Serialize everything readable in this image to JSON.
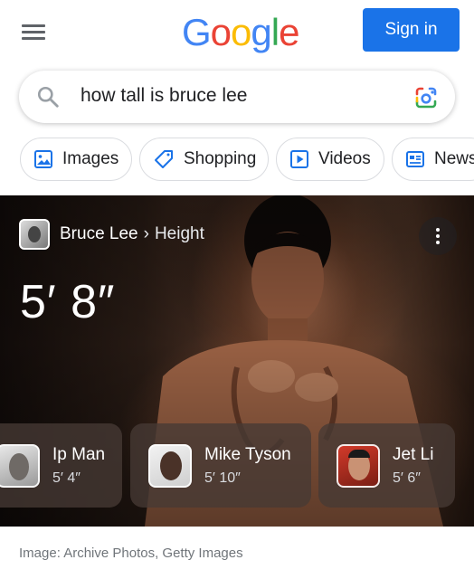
{
  "header": {
    "logo_letters": [
      "G",
      "o",
      "o",
      "g",
      "l",
      "e"
    ],
    "logo_colors": [
      "#4285F4",
      "#EA4335",
      "#FBBC05",
      "#4285F4",
      "#34A853",
      "#EA4335"
    ],
    "signin_label": "Sign in",
    "accent_color": "#1a73e8"
  },
  "search": {
    "query": "how tall is bruce lee",
    "search_icon": "search-icon",
    "lens_icon": "google-lens-icon"
  },
  "chips": [
    {
      "label": "Images",
      "icon": "image-icon"
    },
    {
      "label": "Shopping",
      "icon": "tag-icon"
    },
    {
      "label": "Videos",
      "icon": "play-icon"
    },
    {
      "label": "News",
      "icon": "news-icon"
    }
  ],
  "card": {
    "entity": "Bruce Lee",
    "separator": "›",
    "attribute": "Height",
    "answer": "5′ 8″",
    "more_icon": "more-vert-icon",
    "people": [
      {
        "name": "Ip Man",
        "height": "5′ 4″"
      },
      {
        "name": "Mike Tyson",
        "height": "5′ 10″"
      },
      {
        "name": "Jet Li",
        "height": "5′ 6″"
      }
    ]
  },
  "caption": "Image: Archive Photos, Getty Images"
}
